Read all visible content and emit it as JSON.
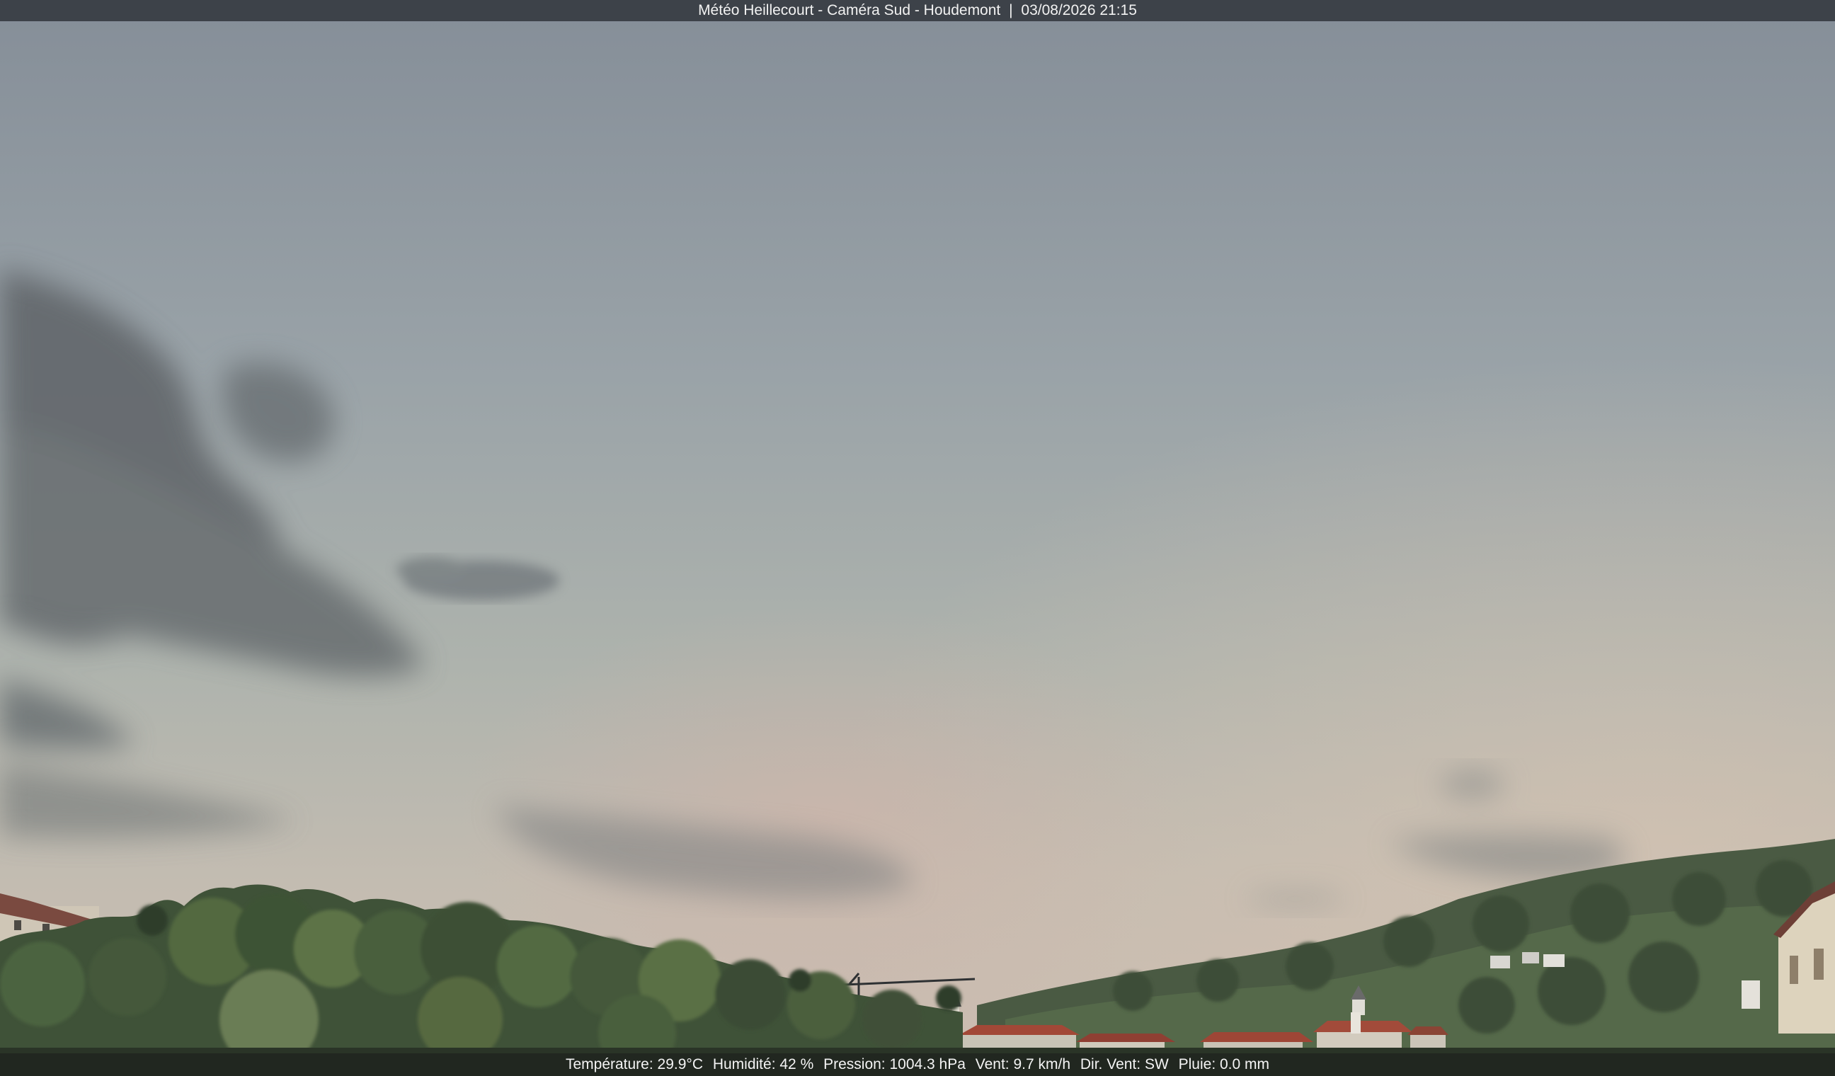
{
  "title_bar": {
    "station": "Météo Heillecourt - Caméra Sud - Houdemont",
    "separator": "|",
    "datetime": "03/08/2026 21:15"
  },
  "weather": [
    {
      "label": "Température:",
      "value": "29.9°C"
    },
    {
      "label": "Humidité:",
      "value": "42 %"
    },
    {
      "label": "Pression:",
      "value": "1004.3 hPa"
    },
    {
      "label": "Vent:",
      "value": "9.7 km/h"
    },
    {
      "label": "Dir. Vent:",
      "value": "SW"
    },
    {
      "label": "Pluie:",
      "value": "0.0 mm"
    }
  ],
  "scene": {
    "description_tags": [
      "evening-sky",
      "clouds",
      "tree-line",
      "hillside",
      "village-rooftops",
      "crane",
      "church-steeple"
    ],
    "colors": {
      "sky_top": "#8a939c",
      "sky_mid": "#a4aeac",
      "sky_horizon": "#c9bdb0",
      "cloud_dark": "#5f6467",
      "vegetation": "#3f5238",
      "roof": "#9a4a3c"
    }
  }
}
